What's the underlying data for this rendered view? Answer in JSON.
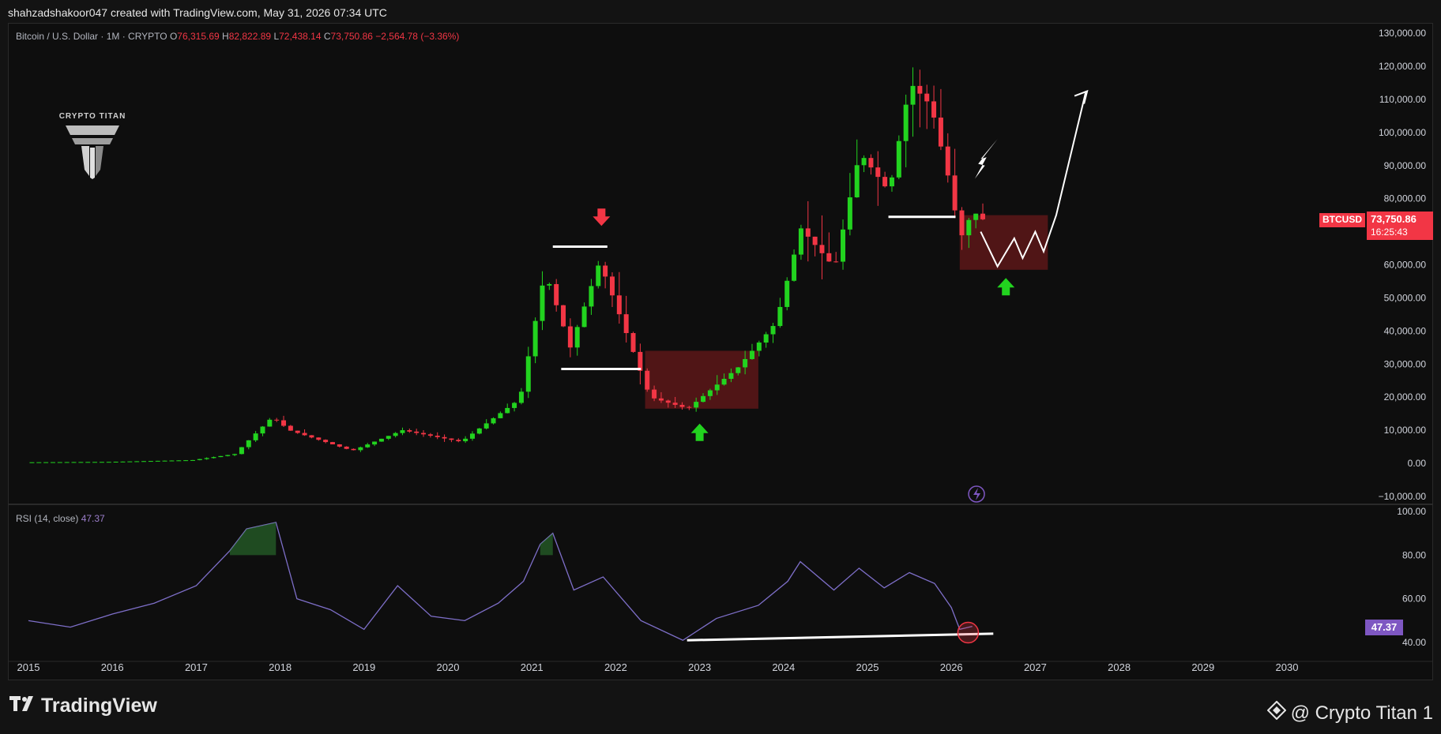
{
  "header": {
    "attribution": "shahzadshakoor047 created with TradingView.com, May 31, 2026 07:34 UTC"
  },
  "legend": {
    "symbol": "Bitcoin / U.S. Dollar · 1M · CRYPTO",
    "o_label": "O",
    "o_value": "76,315.69",
    "h_label": "H",
    "h_value": "82,822.89",
    "l_label": "L",
    "l_value": "72,438.14",
    "c_label": "C",
    "c_value": "73,750.86",
    "change": "−2,564.78 (−3.36%)"
  },
  "rsi_legend": {
    "label": "RSI (14, close)",
    "value": "47.37"
  },
  "brand": {
    "title": "CRYPTO TITAN"
  },
  "price_tag": {
    "ticker": "BTCUSD",
    "price": "73,750.86",
    "countdown": "16:25:43"
  },
  "footer": {
    "logo_text": "TradingView",
    "credit": "@ Crypto Titan 1"
  },
  "colors": {
    "up": "#22d31f",
    "down": "#f23645",
    "rsi": "#7e6fc9",
    "zone": "#5c1618",
    "background": "#0e0e0e"
  },
  "icons": {
    "brand_logo": "titan-logo-icon",
    "replay": "lightning-icon",
    "footer_mark": "diamond-icon"
  },
  "chart_data": {
    "type": "candlestick",
    "price_axis": {
      "ticks": [
        "130,000.00",
        "120,000.00",
        "110,000.00",
        "100,000.00",
        "90,000.00",
        "80,000.00",
        "70,000.00",
        "60,000.00",
        "50,000.00",
        "40,000.00",
        "30,000.00",
        "20,000.00",
        "10,000.00",
        "0.00",
        "−10,000.00"
      ],
      "range": [
        -10000,
        130000
      ]
    },
    "rsi_axis": {
      "ticks": [
        "100.00",
        "80.00",
        "60.00",
        "40.00"
      ],
      "range": [
        37,
        102
      ]
    },
    "time_axis": {
      "ticks": [
        "2015",
        "2016",
        "2017",
        "2018",
        "2019",
        "2020",
        "2021",
        "2022",
        "2023",
        "2024",
        "2025",
        "2026",
        "2027",
        "2028",
        "2029",
        "2030"
      ]
    },
    "key_prices": [
      {
        "t": 2015.0,
        "p": 300
      },
      {
        "t": 2016.0,
        "p": 430
      },
      {
        "t": 2017.0,
        "p": 970
      },
      {
        "t": 2017.5,
        "p": 2800
      },
      {
        "t": 2017.95,
        "p": 14000
      },
      {
        "t": 2018.15,
        "p": 10000
      },
      {
        "t": 2018.9,
        "p": 3800
      },
      {
        "t": 2019.5,
        "p": 10000
      },
      {
        "t": 2020.2,
        "p": 6500
      },
      {
        "t": 2020.9,
        "p": 19500
      },
      {
        "t": 2021.2,
        "p": 58000
      },
      {
        "t": 2021.5,
        "p": 35000
      },
      {
        "t": 2021.85,
        "p": 61000
      },
      {
        "t": 2022.45,
        "p": 20000
      },
      {
        "t": 2022.9,
        "p": 16500
      },
      {
        "t": 2023.5,
        "p": 29000
      },
      {
        "t": 2023.95,
        "p": 42500
      },
      {
        "t": 2024.25,
        "p": 71000
      },
      {
        "t": 2024.65,
        "p": 59000
      },
      {
        "t": 2024.95,
        "p": 94000
      },
      {
        "t": 2025.3,
        "p": 82000
      },
      {
        "t": 2025.55,
        "p": 115000
      },
      {
        "t": 2025.8,
        "p": 108000
      },
      {
        "t": 2026.0,
        "p": 87000
      },
      {
        "t": 2026.15,
        "p": 68000
      },
      {
        "t": 2026.3,
        "p": 76315
      },
      {
        "t": 2026.4,
        "p": 73750
      }
    ],
    "rsi_points": [
      {
        "t": 2015.0,
        "v": 50
      },
      {
        "t": 2015.5,
        "v": 47
      },
      {
        "t": 2016.0,
        "v": 53
      },
      {
        "t": 2016.5,
        "v": 58
      },
      {
        "t": 2017.0,
        "v": 66
      },
      {
        "t": 2017.4,
        "v": 82
      },
      {
        "t": 2017.6,
        "v": 92
      },
      {
        "t": 2017.95,
        "v": 95
      },
      {
        "t": 2018.2,
        "v": 60
      },
      {
        "t": 2018.6,
        "v": 55
      },
      {
        "t": 2019.0,
        "v": 46
      },
      {
        "t": 2019.4,
        "v": 66
      },
      {
        "t": 2019.8,
        "v": 52
      },
      {
        "t": 2020.2,
        "v": 50
      },
      {
        "t": 2020.6,
        "v": 58
      },
      {
        "t": 2020.9,
        "v": 68
      },
      {
        "t": 2021.1,
        "v": 85
      },
      {
        "t": 2021.25,
        "v": 90
      },
      {
        "t": 2021.5,
        "v": 64
      },
      {
        "t": 2021.85,
        "v": 70
      },
      {
        "t": 2022.3,
        "v": 50
      },
      {
        "t": 2022.8,
        "v": 41
      },
      {
        "t": 2023.2,
        "v": 51
      },
      {
        "t": 2023.7,
        "v": 57
      },
      {
        "t": 2024.05,
        "v": 68
      },
      {
        "t": 2024.2,
        "v": 77
      },
      {
        "t": 2024.6,
        "v": 64
      },
      {
        "t": 2024.9,
        "v": 74
      },
      {
        "t": 2025.2,
        "v": 65
      },
      {
        "t": 2025.5,
        "v": 72
      },
      {
        "t": 2025.8,
        "v": 67
      },
      {
        "t": 2026.0,
        "v": 56
      },
      {
        "t": 2026.1,
        "v": 46
      },
      {
        "t": 2026.25,
        "v": 47.37
      }
    ],
    "annotations": {
      "supports": [
        {
          "t0": 2021.35,
          "t1": 2022.3,
          "p": 28500
        },
        {
          "t0": 2025.25,
          "t1": 2026.05,
          "p": 74500
        }
      ],
      "resistance": {
        "t0": 2021.25,
        "t1": 2021.9,
        "p": 65500
      },
      "zones": [
        {
          "t0": 2022.35,
          "t1": 2023.7,
          "p_hi": 34000,
          "p_lo": 16500
        },
        {
          "t0": 2026.1,
          "t1": 2027.15,
          "p_hi": 75000,
          "p_lo": 58500
        }
      ],
      "projection": [
        {
          "t": 2026.35,
          "p": 70000
        },
        {
          "t": 2026.55,
          "p": 59500
        },
        {
          "t": 2026.75,
          "p": 68000
        },
        {
          "t": 2026.85,
          "p": 62000
        },
        {
          "t": 2027.0,
          "p": 70000
        },
        {
          "t": 2027.1,
          "p": 64000
        },
        {
          "t": 2027.25,
          "p": 75000
        },
        {
          "t": 2027.6,
          "p": 112000
        }
      ],
      "rsi_trendline": {
        "t0": 2022.85,
        "v0": 41,
        "t1": 2026.5,
        "v1": 44
      }
    }
  }
}
